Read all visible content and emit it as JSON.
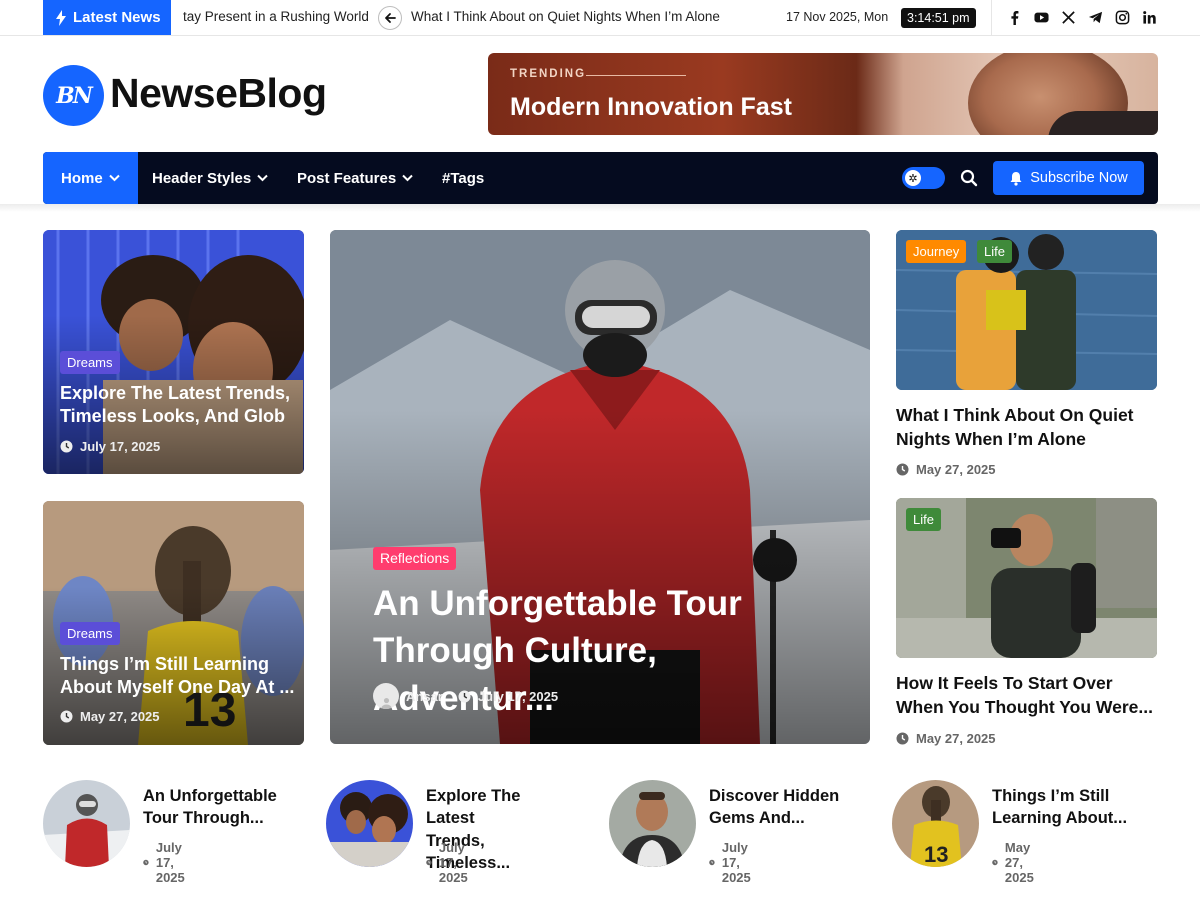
{
  "topbar": {
    "latest_label": "Latest News",
    "ticker_prev_item": "tay Present in a Rushing World",
    "ticker_current_item": "What I Think About on Quiet Nights When I’m Alone",
    "date": "17 Nov 2025, Mon",
    "time": "3:14:51 pm",
    "social_icons": [
      "facebook-icon",
      "youtube-icon",
      "x-icon",
      "telegram-icon",
      "instagram-icon",
      "linkedin-icon"
    ]
  },
  "header": {
    "logo_initials": "BN",
    "site_name": "NewseBlog",
    "trending_label": "TRENDING",
    "trending_title": "Modern Innovation Fast"
  },
  "nav": {
    "items": [
      {
        "label": "Home",
        "has_dropdown": true,
        "active": true
      },
      {
        "label": "Header Styles",
        "has_dropdown": true,
        "active": false
      },
      {
        "label": "Post Features",
        "has_dropdown": true,
        "active": false
      },
      {
        "label": "#Tags",
        "has_dropdown": false,
        "active": false
      }
    ],
    "subscribe_label": "Subscribe Now"
  },
  "colors": {
    "accent": "#1565ff",
    "nav_bg": "#050b1f",
    "tag_dreams": "#5b4ed8",
    "tag_reflections": "#ff3d6e",
    "tag_journey": "#ff8a00",
    "tag_life": "#3f8a3a"
  },
  "left_cards": [
    {
      "tag": "Dreams",
      "title_line1": "Explore The Latest Trends,",
      "title_line2": "Timeless Looks, And Glob",
      "date": "July 17, 2025"
    },
    {
      "tag": "Dreams",
      "title_line1": "Things I’m Still Learning",
      "title_line2": "About Myself One Day At ...",
      "date": "May 27, 2025"
    }
  ],
  "featured": {
    "tag": "Reflections",
    "title_line1": "An Unforgettable Tour",
    "title_line2": "Through Culture, Adventur...",
    "author": "Ansar",
    "date": "July 17, 2025"
  },
  "right_posts": [
    {
      "tags": [
        "Journey",
        "Life"
      ],
      "title_line1": "What I Think About On Quiet",
      "title_line2": "Nights When I’m Alone",
      "date": "May 27, 2025"
    },
    {
      "tags": [
        "Life"
      ],
      "title_line1": "How It Feels To Start Over",
      "title_line2": "When You Thought You Were...",
      "date": "May 27, 2025"
    }
  ],
  "bottom_posts": [
    {
      "title_line1": "An Unforgettable",
      "title_line2": "Tour Through...",
      "date": "July 17, 2025"
    },
    {
      "title_line1": "Explore The Latest",
      "title_line2": "Trends, Timeless...",
      "date": "July 17, 2025"
    },
    {
      "title_line1": "Discover Hidden",
      "title_line2": "Gems And...",
      "date": "July 17, 2025"
    },
    {
      "title_line1": "Things I’m Still",
      "title_line2": "Learning About...",
      "date": "May 27, 2025"
    }
  ]
}
